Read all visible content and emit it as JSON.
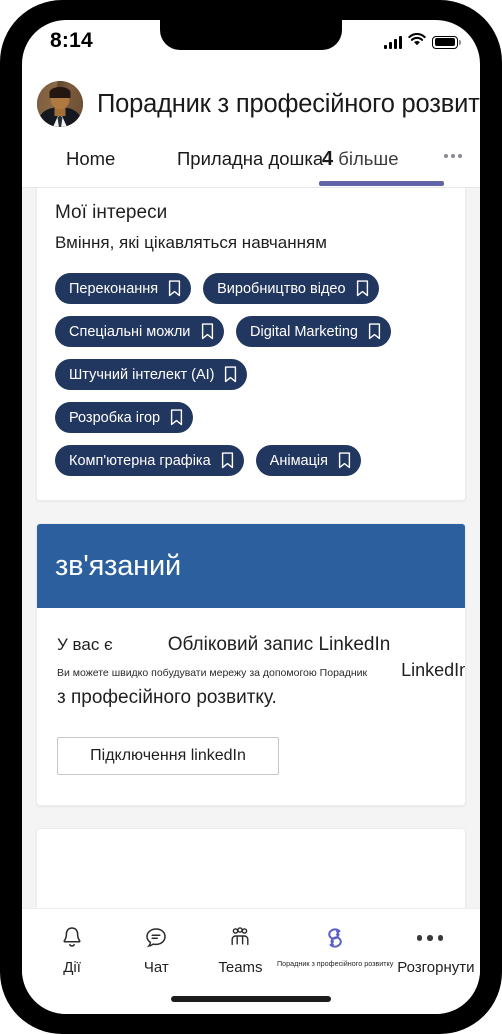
{
  "status_bar": {
    "time": "8:14",
    "signal_icon": "cellular-signal-icon",
    "wifi_icon": "wifi-icon",
    "battery_icon": "battery-icon"
  },
  "header": {
    "avatar_name": "user-avatar",
    "title": "Порадник з професійного розвитку"
  },
  "tabs": {
    "home_label": "Home",
    "dashboard_label": "Приладна дошка",
    "more_count": "4",
    "more_label": "більше",
    "overflow_icon": "more-options-icon",
    "active_tab": "more",
    "underline_color": "#6264a7"
  },
  "interests": {
    "title": "Мої інтереси",
    "subtitle": "Вміння, які цікавляться навчанням",
    "chip_color": "#22375f",
    "bookmark_icon": "bookmark-icon",
    "rows": [
      [
        {
          "label": "Переконання"
        },
        {
          "label": "Виробництво відео"
        }
      ],
      [
        {
          "label": "Спеціальні можливості",
          "truncated": true
        },
        {
          "label": "Digital Marketing"
        }
      ],
      [
        {
          "label": "Штучний інтелект (AI)"
        }
      ],
      [
        {
          "label": "Розробка ігор"
        }
      ],
      [
        {
          "label": "Комп'ютерна графіка"
        },
        {
          "label": "Анімація"
        }
      ]
    ]
  },
  "linkedin": {
    "banner_title": "зв'язаний",
    "banner_color": "#2c5f9e",
    "line1_left": "У вас є",
    "line1_right": "Обліковий запис LinkedIn",
    "line2_small": "Ви можете швидко побудувати мережу за допомогою Порадник",
    "line2_brand": "LinkedIn",
    "line3": "з професійного розвитку.",
    "button_label": "Підключення linkedIn"
  },
  "bottom_nav": {
    "items": [
      {
        "label": "Дії",
        "icon": "bell-icon",
        "active": false
      },
      {
        "label": "Чат",
        "icon": "chat-icon",
        "active": false
      },
      {
        "label": "Teams",
        "icon": "teams-people-icon",
        "active": false
      },
      {
        "label": "Порадник з професійного розвитку",
        "icon": "viva-insights-icon",
        "active": true
      },
      {
        "label": "Розгорнути",
        "icon": "more-dots-icon",
        "active": false
      }
    ],
    "active_color": "#5b5fc7"
  }
}
